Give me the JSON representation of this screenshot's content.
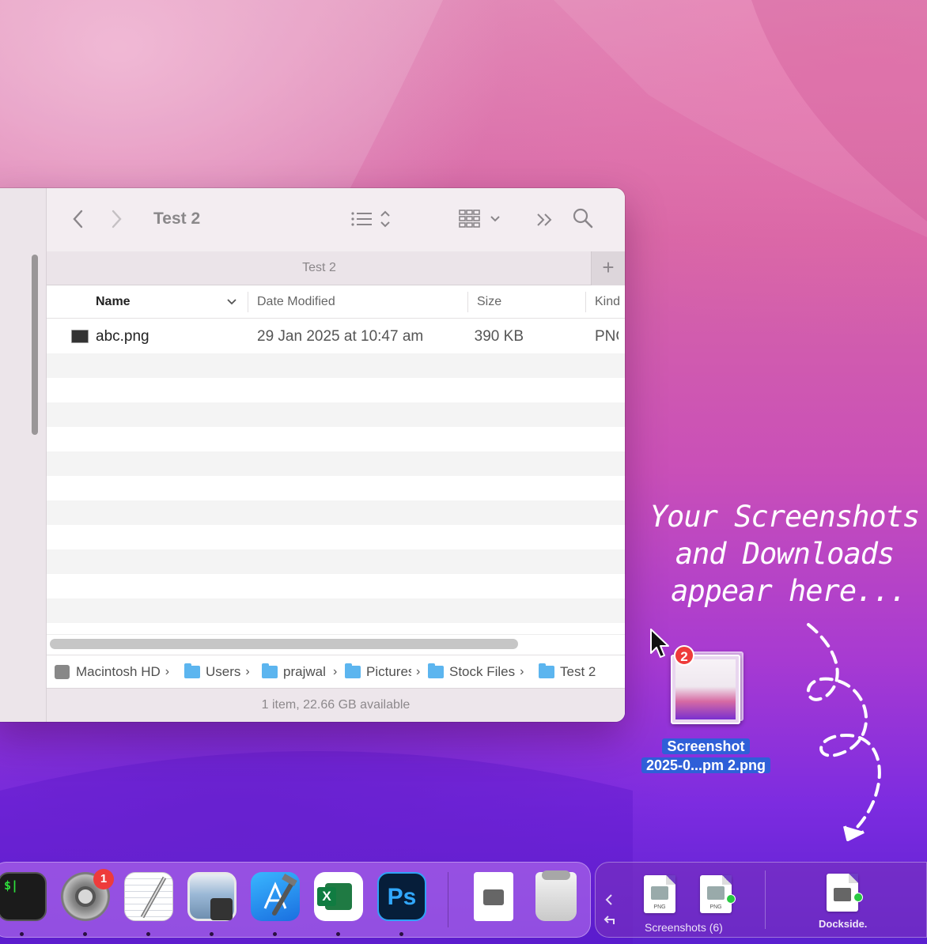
{
  "finder": {
    "title": "Test 2",
    "tab_label": "Test 2",
    "tab_add": "+",
    "columns": {
      "name": "Name",
      "date_modified": "Date Modified",
      "size": "Size",
      "kind": "Kind"
    },
    "files": [
      {
        "name": "abc.png",
        "date_modified": "29 Jan 2025 at 10:47 am",
        "size": "390 KB",
        "kind": "PNG"
      }
    ],
    "path": [
      {
        "label": "Macintosh HD",
        "icon": "hard-drive-icon"
      },
      {
        "label": "Users",
        "icon": "folder-icon"
      },
      {
        "label": "prajwal",
        "icon": "folder-icon"
      },
      {
        "label": "Pictures",
        "icon": "folder-icon"
      },
      {
        "label": "Stock Files",
        "icon": "folder-icon"
      },
      {
        "label": "Test 2",
        "icon": "folder-icon"
      }
    ],
    "status": "1 item, 22.66 GB available"
  },
  "annotation": {
    "line1": "Your Screenshots",
    "line2": "and Downloads",
    "line3": "appear here..."
  },
  "drag": {
    "badge_count": "2",
    "label_line1": "Screenshot",
    "label_line2": "2025-0...pm 2.png"
  },
  "dock": {
    "apps": [
      {
        "name": "Terminal",
        "icon": "terminal-icon"
      },
      {
        "name": "System Settings",
        "icon": "gear-icon",
        "badge": "1"
      },
      {
        "name": "TextEdit",
        "icon": "textedit-icon"
      },
      {
        "name": "Preview",
        "icon": "preview-icon"
      },
      {
        "name": "Xcode",
        "icon": "xcode-icon"
      },
      {
        "name": "Excel",
        "icon": "excel-icon"
      },
      {
        "name": "Photoshop",
        "icon": "photoshop-icon"
      },
      {
        "name": "Downloads Stack",
        "icon": "disk-image-icon"
      },
      {
        "name": "Trash",
        "icon": "trash-icon"
      }
    ],
    "terminal_prompt": "$|",
    "excel_letter": "X",
    "photoshop_letters": "Ps"
  },
  "dockside": {
    "file_label": "PNG",
    "screenshots_label": "Screenshots (6)",
    "app_label": "Dockside."
  },
  "colors": {
    "accent_blue": "#2f5fd8",
    "badge_red": "#ee3b3b",
    "folder_blue": "#5cb5ef",
    "status_green": "#29c842"
  }
}
